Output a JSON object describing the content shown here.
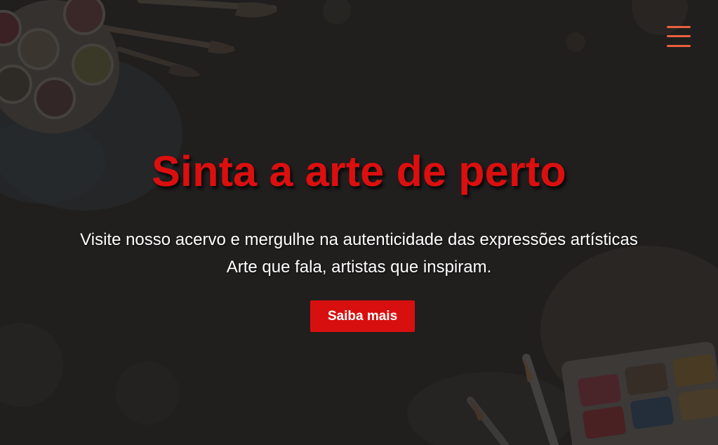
{
  "nav": {
    "menu_icon": "hamburger-menu-icon"
  },
  "hero": {
    "title": "Sinta a arte de perto",
    "subtitle_line1": "Visite nosso acervo e mergulhe na autenticidade das expressões artísticas",
    "subtitle_line2": "Arte que fala, artistas que inspiram.",
    "cta_label": "Saiba mais"
  },
  "colors": {
    "background": "#232221",
    "title": "#dc0f0f",
    "cta_background": "#d80f0f",
    "menu_icon": "#e8613f",
    "text": "#ffffff"
  }
}
